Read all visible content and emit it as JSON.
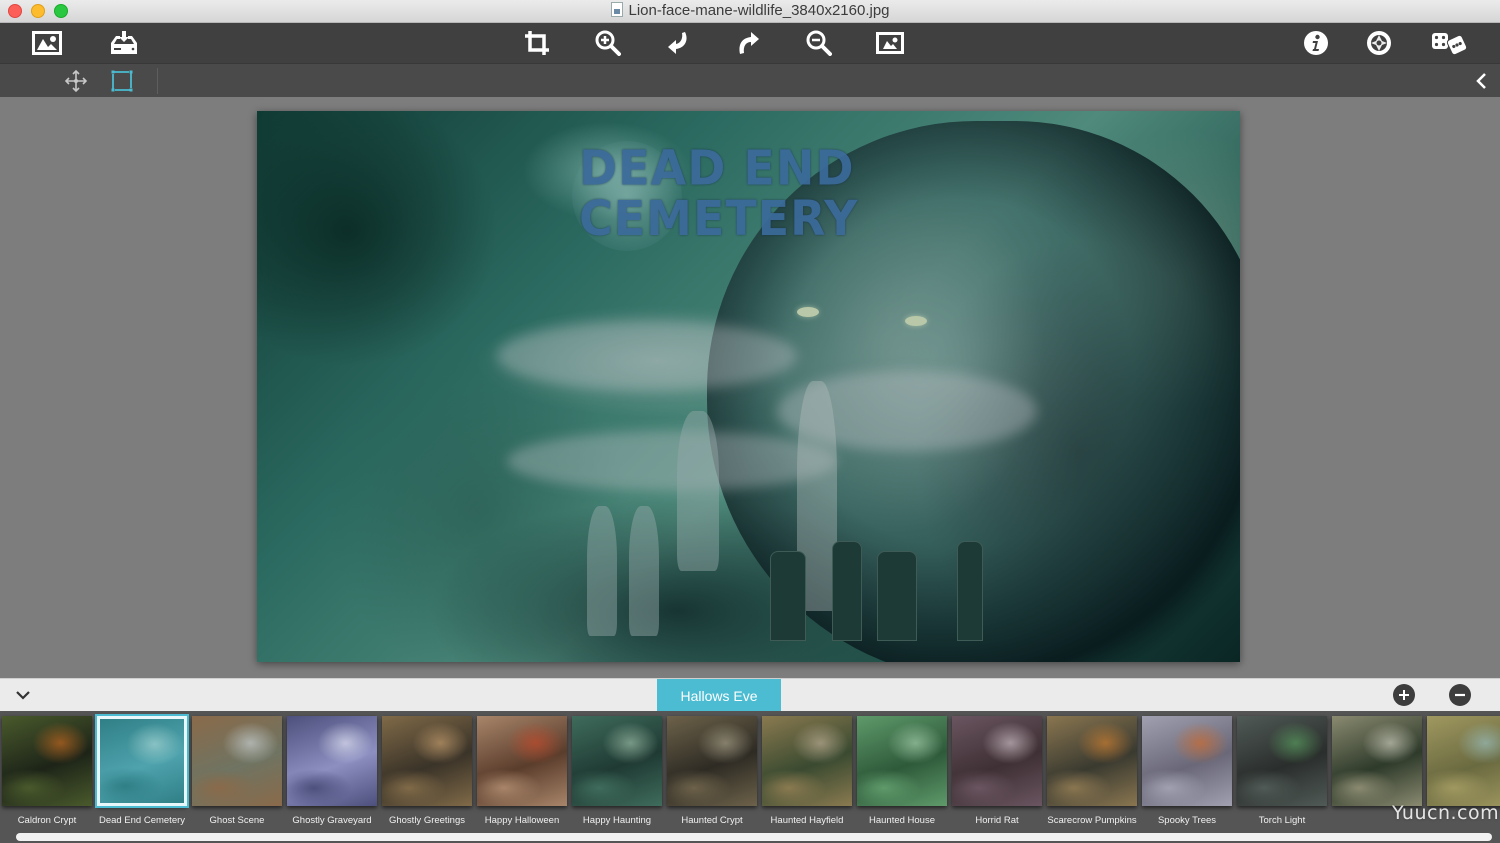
{
  "window": {
    "title": "Lion-face-mane-wildlife_3840x2160.jpg",
    "file_icon": "jpg-document-icon"
  },
  "toolbar": {
    "left": [
      {
        "name": "open-image",
        "icon": "picture-frame-icon"
      },
      {
        "name": "save-export",
        "icon": "tray-download-icon"
      }
    ],
    "center": [
      {
        "name": "crop",
        "icon": "crop-icon"
      },
      {
        "name": "zoom-in",
        "icon": "zoom-in-icon"
      },
      {
        "name": "rotate-left",
        "icon": "rotate-left-arrow-icon"
      },
      {
        "name": "rotate-right",
        "icon": "rotate-right-arrow-icon"
      },
      {
        "name": "zoom-out",
        "icon": "zoom-out-icon"
      },
      {
        "name": "fit-to-window",
        "icon": "picture-frame-icon"
      }
    ],
    "right": [
      {
        "name": "info",
        "icon": "info-icon"
      },
      {
        "name": "settings",
        "icon": "aperture-icon"
      },
      {
        "name": "random",
        "icon": "dice-icon"
      }
    ]
  },
  "subtoolbar": {
    "tools": [
      {
        "name": "move",
        "icon": "move-arrows-icon",
        "active": false
      },
      {
        "name": "select",
        "icon": "selection-rect-icon",
        "active": true
      }
    ],
    "collapse_icon": "chevron-left-icon"
  },
  "canvas": {
    "overlay_text_line1": "Dead End",
    "overlay_text_line2": "Cemetery"
  },
  "panel": {
    "category": "Hallows Eve",
    "accent_color": "#4bbcd2",
    "add_label": "+",
    "remove_label": "−",
    "thumbnails": [
      {
        "label": "Caldron Crypt",
        "selected": false
      },
      {
        "label": "Dead End Cemetery",
        "selected": true
      },
      {
        "label": "Ghost Scene",
        "selected": false
      },
      {
        "label": "Ghostly Graveyard",
        "selected": false
      },
      {
        "label": "Ghostly Greetings",
        "selected": false
      },
      {
        "label": "Happy Halloween",
        "selected": false
      },
      {
        "label": "Happy Haunting",
        "selected": false
      },
      {
        "label": "Haunted Crypt",
        "selected": false
      },
      {
        "label": "Haunted Hayfield",
        "selected": false
      },
      {
        "label": "Haunted House",
        "selected": false
      },
      {
        "label": "Horrid Rat",
        "selected": false
      },
      {
        "label": "Scarecrow Pumpkins",
        "selected": false
      },
      {
        "label": "Spooky Trees",
        "selected": false
      },
      {
        "label": "Torch Light",
        "selected": false
      },
      {
        "label": "",
        "selected": false
      },
      {
        "label": "",
        "selected": false
      }
    ]
  },
  "watermark": "Yuucn.com"
}
